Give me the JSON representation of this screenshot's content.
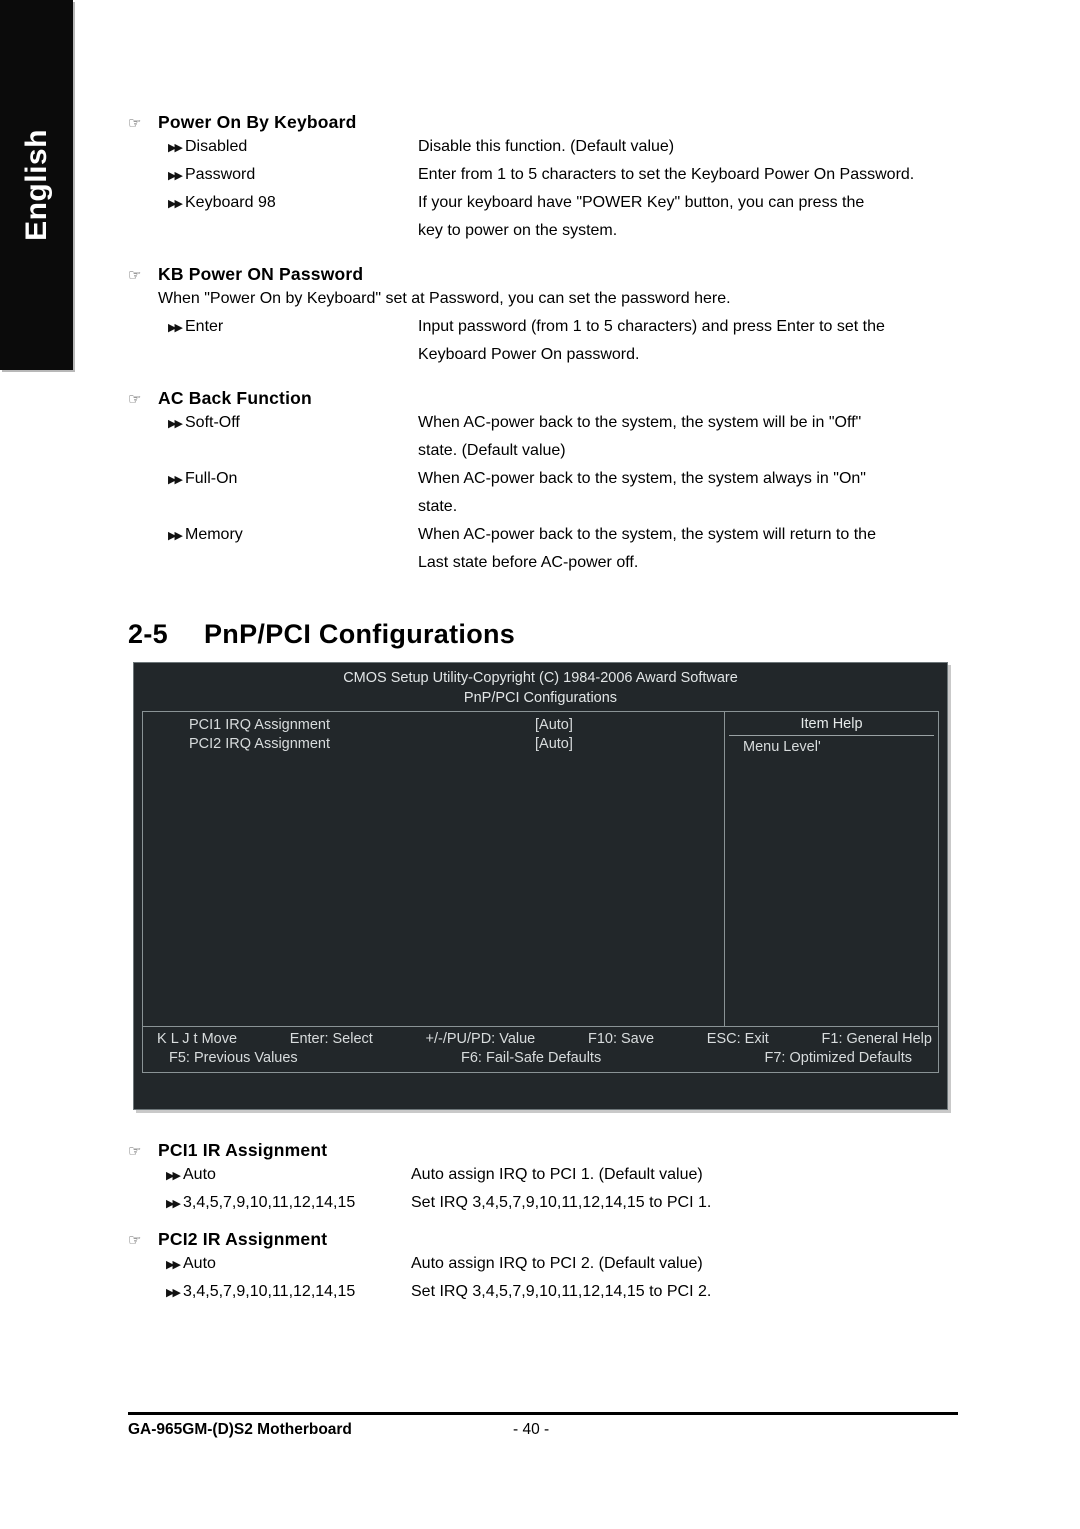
{
  "sidebar": {
    "language_tab": "English"
  },
  "icons": {
    "hand": "☞",
    "bullet": "▶▶"
  },
  "sections": [
    {
      "name": "power-on-by-keyboard",
      "title": "Power On By Keyboard",
      "options": [
        {
          "label": "Disabled",
          "desc": "Disable this function. (Default value)"
        },
        {
          "label": "Password",
          "desc": "Enter from 1 to 5 characters to set the Keyboard Power On Password."
        },
        {
          "label": "Keyboard 98",
          "desc": "If your keyboard have \"POWER Key\" button, you can press the",
          "cont": "key to power on the system."
        }
      ]
    },
    {
      "name": "kb-power-on-password",
      "title": "KB Power ON Password",
      "note": "When \"Power On by Keyboard\" set at Password, you can set the password here.",
      "options": [
        {
          "label": "Enter",
          "desc": "Input password (from 1 to 5 characters) and press Enter to set the",
          "cont": "Keyboard Power On password."
        }
      ]
    },
    {
      "name": "ac-back-function",
      "title": "AC Back Function",
      "options": [
        {
          "label": "Soft-Off",
          "desc": "When AC-power back to the system, the system will be in \"Off\"",
          "cont": "state. (Default value)"
        },
        {
          "label": "Full-On",
          "desc": "When AC-power back to the system, the system always in \"On\"",
          "cont": "state."
        },
        {
          "label": "Memory",
          "desc": "When AC-power back to the system, the system will return to the",
          "cont": "Last state before AC-power off."
        }
      ]
    }
  ],
  "chapter": {
    "number": "2-5",
    "title": "PnP/PCI Configurations"
  },
  "bios": {
    "title_line1": "CMOS Setup Utility-Copyright (C) 1984-2006 Award Software",
    "title_line2": "PnP/PCI Configurations",
    "rows": [
      {
        "item": "PCI1 IRQ Assignment",
        "value": "[Auto]"
      },
      {
        "item": "PCI2 IRQ Assignment",
        "value": "[Auto]"
      }
    ],
    "help": {
      "title": "Item Help",
      "menu_level": "Menu Level'"
    },
    "footer_line1": [
      "K L J t Move",
      "Enter: Select",
      "+/-/PU/PD: Value",
      "F10: Save",
      "ESC: Exit",
      "F1: General Help"
    ],
    "footer_line2": [
      "F5: Previous Values",
      "F6: Fail-Safe Defaults",
      "F7: Optimized Defaults"
    ]
  },
  "sections_bottom": [
    {
      "name": "pci1-ir-assignment",
      "title": "PCI1 IR Assignment",
      "options": [
        {
          "label": "Auto",
          "desc": "Auto assign IRQ to PCI 1. (Default value)"
        },
        {
          "label": "3,4,5,7,9,10,11,12,14,15",
          "desc": "Set IRQ 3,4,5,7,9,10,11,12,14,15 to PCI 1."
        }
      ]
    },
    {
      "name": "pci2-ir-assignment",
      "title": "PCI2 IR Assignment",
      "options": [
        {
          "label": "Auto",
          "desc": "Auto assign IRQ to PCI 2. (Default value)"
        },
        {
          "label": "3,4,5,7,9,10,11,12,14,15",
          "desc": "Set IRQ 3,4,5,7,9,10,11,12,14,15 to PCI 2."
        }
      ]
    }
  ],
  "footer": {
    "product": "GA-965GM-(D)S2 Motherboard",
    "page": "- 40 -"
  },
  "colors": {
    "tab_background": "#0b0b0b",
    "bios_background": "#22272a",
    "bios_text": "#d8dcdd",
    "bios_border": "#8a9395"
  }
}
